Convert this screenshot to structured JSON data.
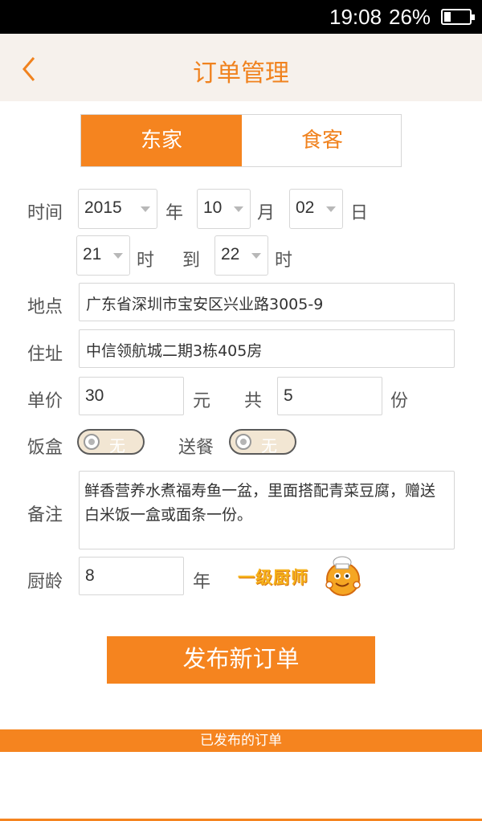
{
  "status_bar": {
    "time": "19:08",
    "battery": "26%"
  },
  "header": {
    "title": "订单管理"
  },
  "role_tabs": [
    {
      "label": "东家",
      "selected": true
    },
    {
      "label": "食客",
      "selected": false
    }
  ],
  "time_section": {
    "label": "时间",
    "year": "2015",
    "year_unit": "年",
    "month": "10",
    "month_unit": "月",
    "day": "02",
    "day_unit": "日",
    "start_hour": "21",
    "start_unit": "时",
    "to_label": "到",
    "end_hour": "22",
    "end_unit": "时"
  },
  "location": {
    "label": "地点",
    "value": "广东省深圳市宝安区兴业路3005-9"
  },
  "address": {
    "label": "住址",
    "value": "中信领航城二期3栋405房"
  },
  "price": {
    "label": "单价",
    "value": "30",
    "unit": "元",
    "count_label": "共",
    "count": "5",
    "count_unit": "份"
  },
  "lunchbox": {
    "label": "饭盒",
    "toggle_text": "无"
  },
  "delivery": {
    "label": "送餐",
    "toggle_text": "无"
  },
  "remarks": {
    "label": "备注",
    "value": "鲜香营养水煮福寿鱼一盆，里面搭配青菜豆腐，赠送白米饭一盒或面条一份。"
  },
  "chef": {
    "label": "厨龄",
    "value": "8",
    "unit": "年",
    "rank": "一级厨师"
  },
  "publish_button": "发布新订单",
  "published_section": "已发布的订单",
  "colors": {
    "accent": "#f5841f",
    "header_bg": "#f6f1ec",
    "title": "#f0821e"
  }
}
